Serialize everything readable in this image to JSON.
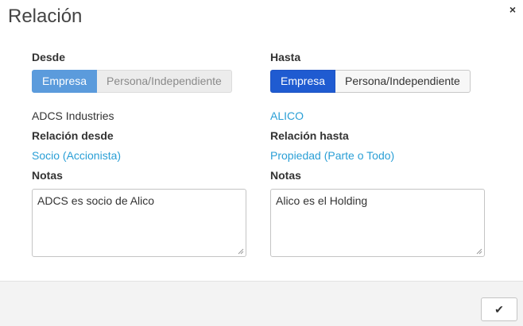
{
  "dialog": {
    "title": "Relación",
    "close_icon": "close-icon",
    "close_glyph": "×"
  },
  "left": {
    "label": "Desde",
    "toggle": {
      "option_company": "Empresa",
      "option_person": "Persona/Independiente",
      "selected": "Empresa"
    },
    "entity_name": "ADCS Industries",
    "relation_label": "Relación desde",
    "relation_value": "Socio (Accionista)",
    "notes_label": "Notas",
    "notes_value": "ADCS es socio de Alico"
  },
  "right": {
    "label": "Hasta",
    "toggle": {
      "option_company": "Empresa",
      "option_person": "Persona/Independiente",
      "selected": "Empresa"
    },
    "entity_name": "ALICO",
    "relation_label": "Relación hasta",
    "relation_value": "Propiedad (Parte o Todo)",
    "notes_label": "Notas",
    "notes_value": "Alico es el Holding"
  },
  "footer": {
    "confirm_icon": "checkmark-icon",
    "confirm_glyph": "✔"
  },
  "colors": {
    "link": "#2a9fd6",
    "left_toggle_active": "#5b9bdc",
    "right_toggle_active": "#1f5bd1",
    "footer_bg": "#f3f3f3"
  }
}
